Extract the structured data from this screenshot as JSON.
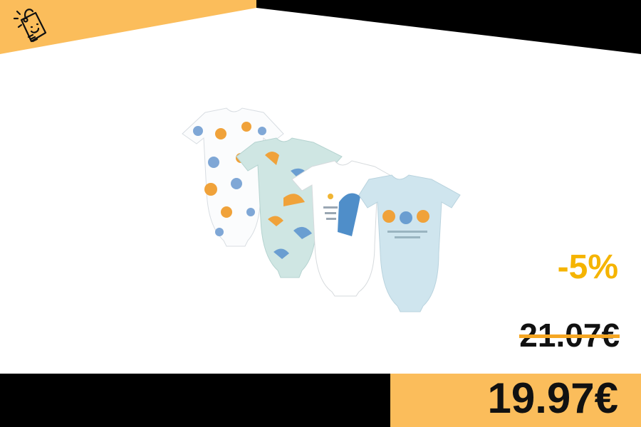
{
  "product": {
    "discount_label": "-5%",
    "original_price": "21.07€",
    "sale_price": "19.97€"
  },
  "colors": {
    "accent": "#fbbd5b",
    "discount_text": "#f5b400",
    "dark": "#000000",
    "strike": "#f5a623"
  },
  "icons": {
    "logo": "smiling-price-tag-icon"
  }
}
